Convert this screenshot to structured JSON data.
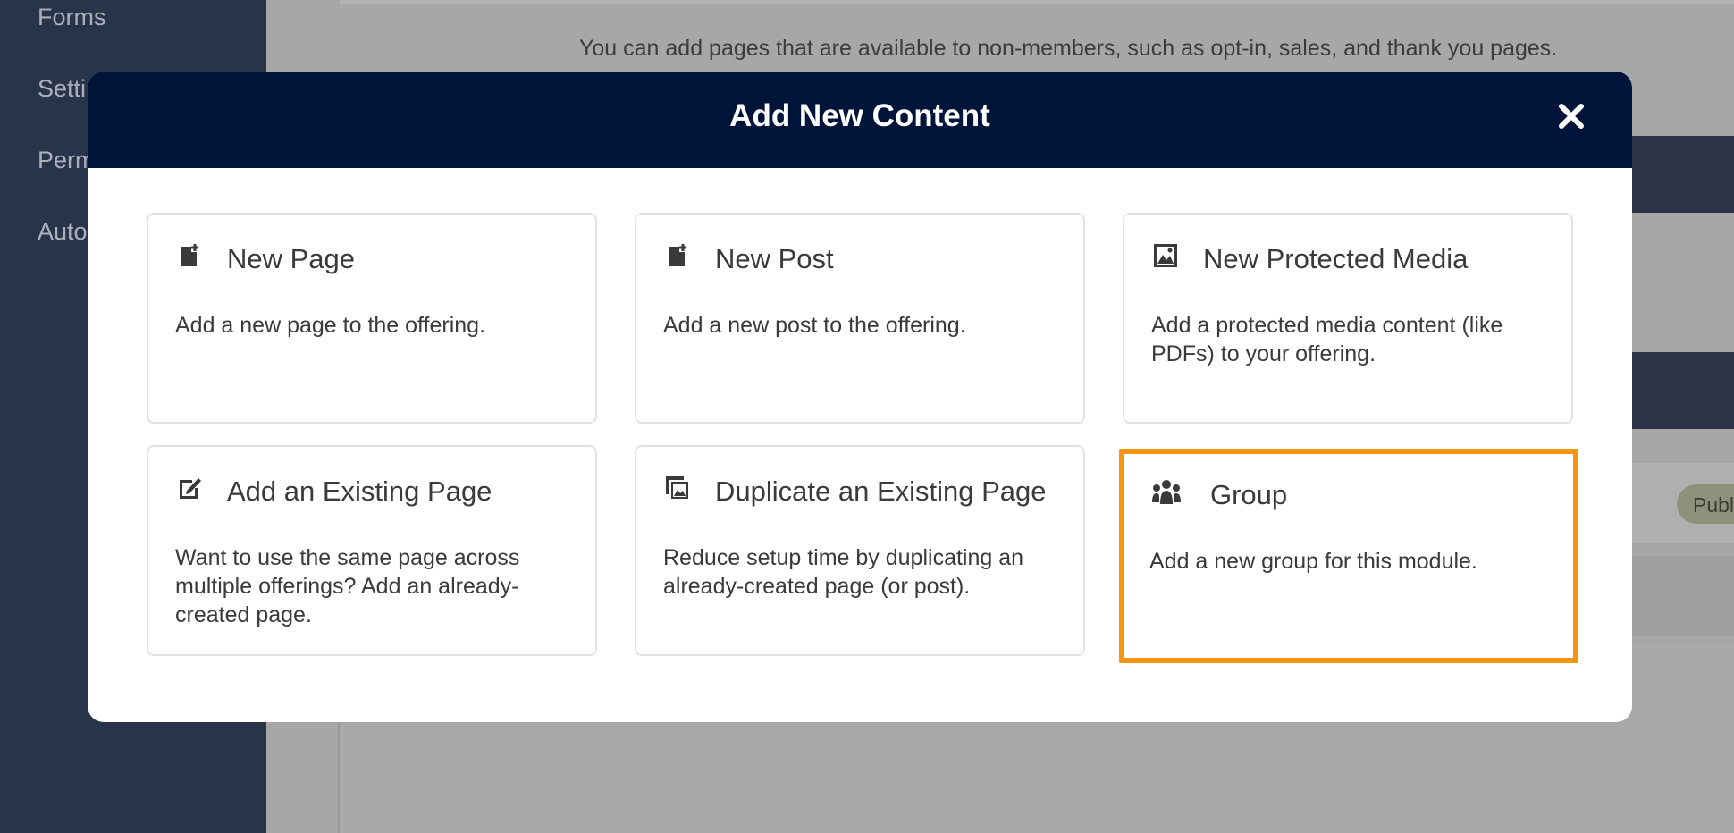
{
  "sidebar": {
    "items": [
      {
        "label": "Forms"
      },
      {
        "label": "Setti"
      },
      {
        "label": "Perm"
      },
      {
        "label": "Auto"
      }
    ]
  },
  "background": {
    "info_text": "You can add pages that are available to non-members, such as opt-in, sales, and thank you pages.",
    "badge": "Publ"
  },
  "modal": {
    "title": "Add New Content",
    "close_icon": "close-icon",
    "cards": [
      {
        "icon": "new-page-icon",
        "title": "New Page",
        "description": "Add a new page to the offering."
      },
      {
        "icon": "new-post-icon",
        "title": "New Post",
        "description": "Add a new post to the offering."
      },
      {
        "icon": "media-icon",
        "title": "New Protected Media",
        "description": "Add a protected media content (like PDFs) to your offering."
      },
      {
        "icon": "edit-page-icon",
        "title": "Add an Existing Page",
        "description": "Want to use the same page across multiple offerings? Add an already-created page."
      },
      {
        "icon": "duplicate-icon",
        "title": "Duplicate an Existing Page",
        "description": "Reduce setup time by duplicating an already-created page (or post)."
      },
      {
        "icon": "group-icon",
        "title": "Group",
        "description": "Add a new group for this module."
      }
    ]
  },
  "colors": {
    "header": "#00143a",
    "highlight": "#f8950f",
    "sidebar": "#29344a"
  }
}
